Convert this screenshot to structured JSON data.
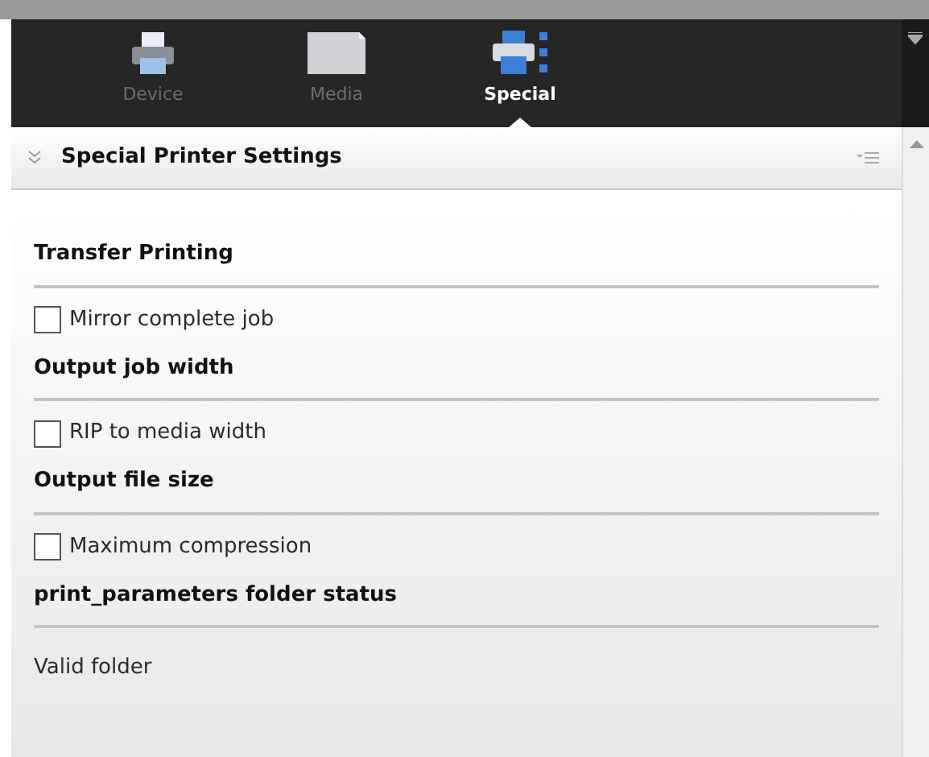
{
  "tabs": [
    {
      "label": "Device",
      "kind": "printer",
      "selected": false
    },
    {
      "label": "Media",
      "kind": "media",
      "selected": false
    },
    {
      "label": "Special",
      "kind": "special",
      "selected": true
    }
  ],
  "panel": {
    "title": "Special Printer Settings"
  },
  "sections": [
    {
      "heading": "Transfer Printing",
      "item": {
        "kind": "checkbox",
        "label": "Mirror complete job",
        "checked": false
      }
    },
    {
      "heading": "Output job width",
      "item": {
        "kind": "checkbox",
        "label": "RIP to media width",
        "checked": false
      }
    },
    {
      "heading": "Output file size",
      "item": {
        "kind": "checkbox",
        "label": "Maximum compression",
        "checked": false
      }
    },
    {
      "heading": "print_parameters folder status",
      "item": {
        "kind": "text",
        "label": "Valid folder"
      }
    }
  ]
}
